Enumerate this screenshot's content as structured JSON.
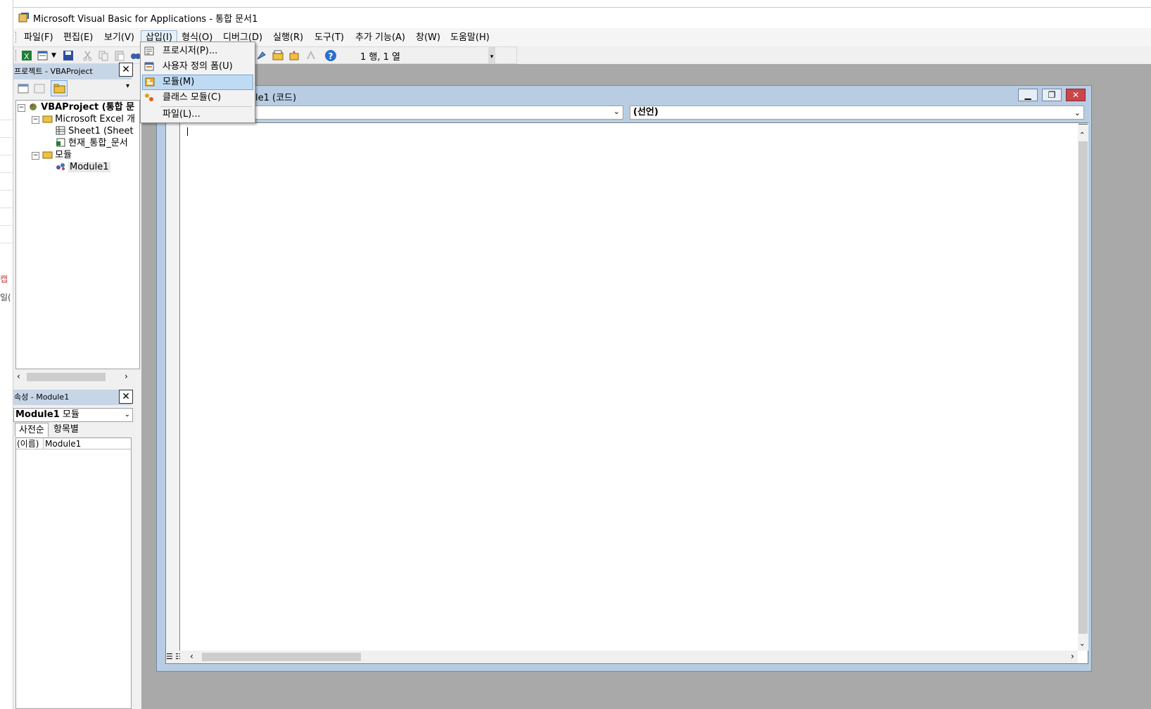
{
  "window": {
    "title": "Microsoft Visual Basic for Applications - 통합 문서1"
  },
  "menubar": {
    "items": [
      "파일(F)",
      "편집(E)",
      "보기(V)",
      "삽입(I)",
      "형식(O)",
      "디버그(D)",
      "실행(R)",
      "도구(T)",
      "추가 기능(A)",
      "창(W)",
      "도움말(H)"
    ],
    "active": "삽입(I)"
  },
  "insert_menu": {
    "items": [
      "프로시저(P)...",
      "사용자 정의 폼(U)",
      "모듈(M)",
      "클래스 모듈(C)",
      "파일(L)..."
    ],
    "highlighted": "모듈(M)"
  },
  "toolbar": {
    "cursor_status": "1 행, 1 열"
  },
  "project_pane": {
    "title": "프로젝트 - VBAProject",
    "tree": [
      {
        "label": "VBAProject (통합 문",
        "bold": true
      },
      {
        "label": "Microsoft Excel 개"
      },
      {
        "label": "Sheet1 (Sheet"
      },
      {
        "label": "현재_통합_문서"
      },
      {
        "label": "모듈"
      },
      {
        "label": "Module1"
      }
    ]
  },
  "properties_pane": {
    "title": "속성 - Module1",
    "object_name": "Module1",
    "object_type": "모듈",
    "tabs": [
      "사전순",
      "항목별"
    ],
    "row": {
      "name": "(이름)",
      "value": "Module1"
    }
  },
  "code_window": {
    "title_visible": "le1 (코드)",
    "object_combo": "",
    "procedure_combo": "(선언)"
  },
  "background": {
    "fragments": [
      "캡",
      "일("
    ]
  }
}
